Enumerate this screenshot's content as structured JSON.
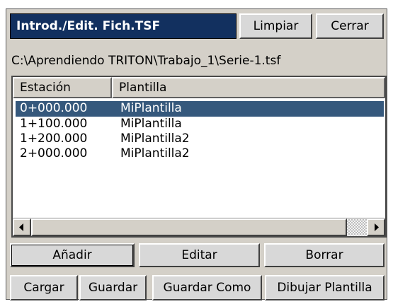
{
  "window": {
    "title": "Introd./Edit. Fich.TSF",
    "clear_label": "Limpiar",
    "close_label": "Cerrar"
  },
  "file_path": "C:\\Aprendiendo TRITON\\Trabajo_1\\Serie-1.tsf",
  "table": {
    "headers": [
      "Estación",
      "Plantilla"
    ],
    "rows": [
      {
        "estacion": "0+000.000",
        "plantilla": "MiPlantilla",
        "selected": true
      },
      {
        "estacion": "1+100.000",
        "plantilla": "MiPlantilla",
        "selected": false
      },
      {
        "estacion": "1+200.000",
        "plantilla": "MiPlantilla2",
        "selected": false
      },
      {
        "estacion": "2+000.000",
        "plantilla": "MiPlantilla2",
        "selected": false
      }
    ]
  },
  "actions": {
    "add": "Añadir",
    "edit": "Editar",
    "delete": "Borrar",
    "load": "Cargar",
    "save": "Guardar",
    "save_as": "Guardar Como",
    "draw_template": "Dibujar Plantilla"
  },
  "icons": {
    "scroll_left": "triangle-left-icon",
    "scroll_right": "triangle-right-icon"
  },
  "colors": {
    "title_bg": "#12305f",
    "selection_bg": "#35587c",
    "dialog_bg": "#d4d0c8"
  }
}
